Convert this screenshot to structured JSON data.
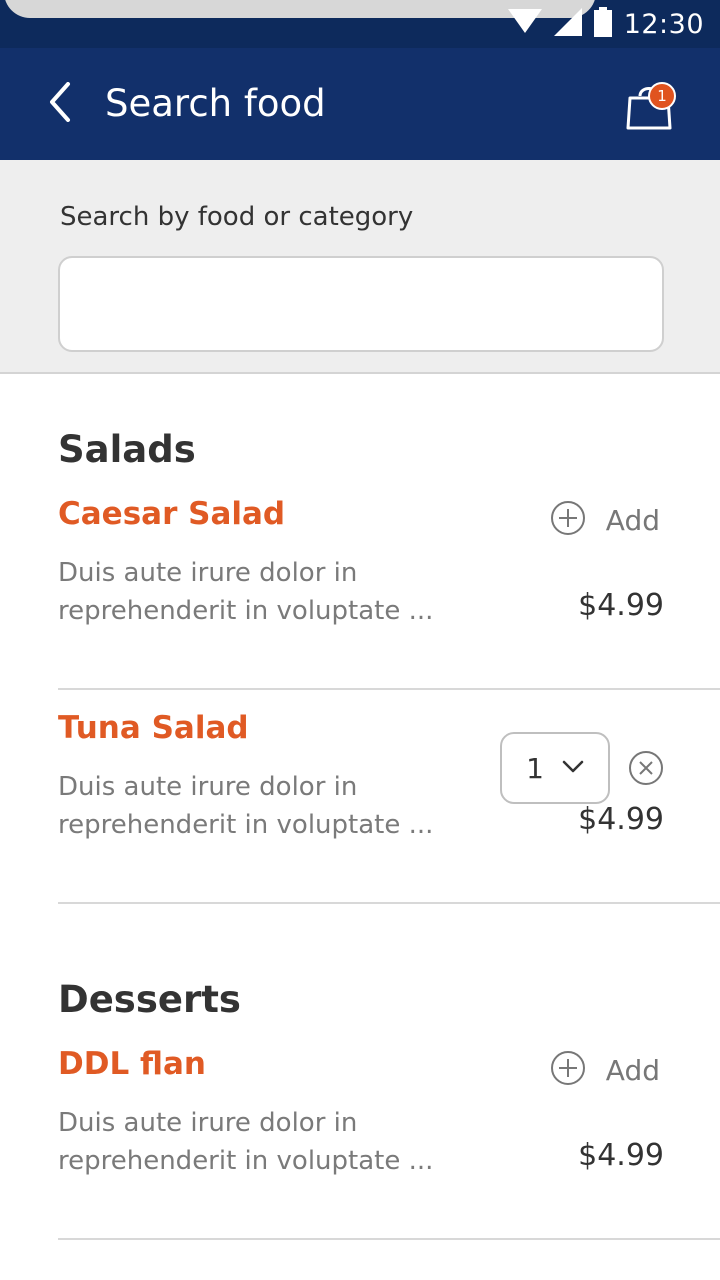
{
  "status_bar": {
    "time": "12:30"
  },
  "header": {
    "title": "Search food",
    "cart_count": "1"
  },
  "search": {
    "label": "Search by food or category",
    "value": "",
    "placeholder": ""
  },
  "categories": [
    {
      "title": "Salads",
      "items": [
        {
          "name": "Caesar Salad",
          "description_line1": "Duis aute irure dolor in",
          "description_line2": "reprehenderit in voluptate ...",
          "price": "$4.99",
          "action": "Add"
        },
        {
          "name": "Tuna Salad",
          "description_line1": "Duis aute irure dolor in",
          "description_line2": "reprehenderit in voluptate ...",
          "price": "$4.99",
          "quantity": "1"
        }
      ]
    },
    {
      "title": "Desserts",
      "items": [
        {
          "name": "DDL flan",
          "description_line1": "Duis aute irure dolor in",
          "description_line2": "reprehenderit in voluptate ...",
          "price": "$4.99",
          "action": "Add"
        }
      ]
    }
  ],
  "colors": {
    "status_bar": "#0d2a5c",
    "app_bar": "#12306b",
    "accent": "#e05a24",
    "badge": "#e0531f"
  },
  "icons": {
    "back": "chevron-left-icon",
    "cart": "shopping-bag-icon",
    "add": "plus-circle-icon",
    "dropdown": "chevron-down-icon",
    "remove": "close-circle-icon",
    "wifi": "wifi-icon",
    "signal": "signal-icon",
    "battery": "battery-icon"
  }
}
